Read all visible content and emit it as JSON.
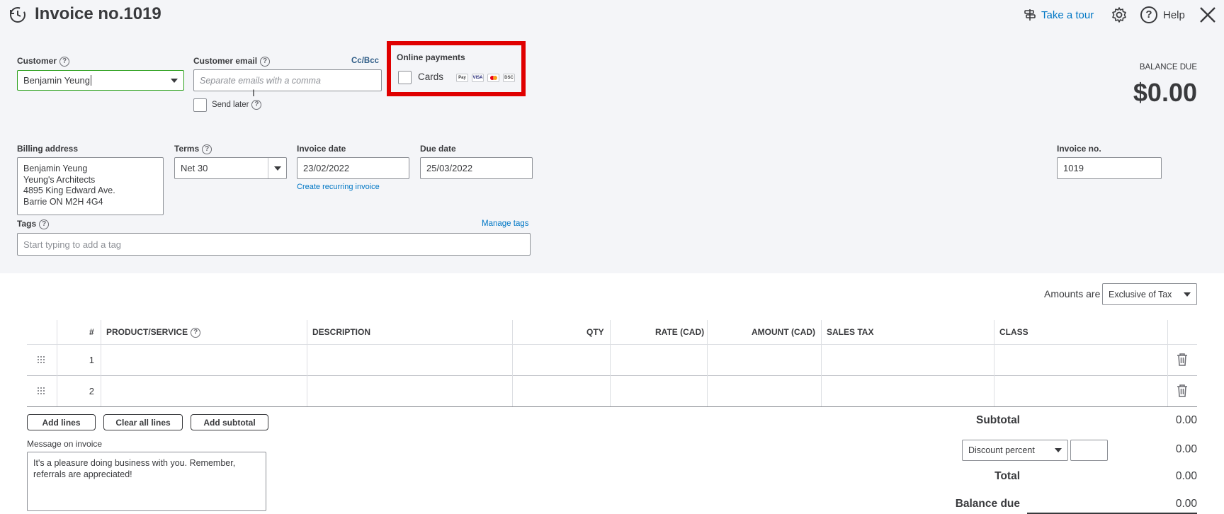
{
  "header": {
    "title": "Invoice no.1019",
    "take_tour": "Take a tour",
    "help": "Help"
  },
  "customer": {
    "label": "Customer",
    "value": "Benjamin Yeung"
  },
  "email": {
    "label": "Customer email",
    "cc_bcc": "Cc/Bcc",
    "placeholder": "Separate emails with a comma",
    "send_later": "Send later"
  },
  "online_payments": {
    "title": "Online payments",
    "cards_label": "Cards",
    "highlight_color": "#e00000"
  },
  "balance": {
    "label": "BALANCE DUE",
    "amount": "$0.00"
  },
  "billing": {
    "label": "Billing address",
    "lines": [
      "Benjamin Yeung",
      "Yeung's Architects",
      "4895 King Edward Ave.",
      "Barrie ON  M2H 4G4"
    ]
  },
  "terms": {
    "label": "Terms",
    "value": "Net 30"
  },
  "invoice_date": {
    "label": "Invoice date",
    "value": "23/02/2022",
    "recurring_link": "Create recurring invoice"
  },
  "due_date": {
    "label": "Due date",
    "value": "25/03/2022"
  },
  "invoice_no": {
    "label": "Invoice no.",
    "value": "1019"
  },
  "tags": {
    "label": "Tags",
    "manage": "Manage tags",
    "placeholder": "Start typing to add a tag"
  },
  "amounts": {
    "label": "Amounts are",
    "value": "Exclusive of Tax"
  },
  "table": {
    "columns": [
      "#",
      "PRODUCT/SERVICE",
      "DESCRIPTION",
      "QTY",
      "RATE (CAD)",
      "AMOUNT (CAD)",
      "SALES TAX",
      "CLASS"
    ],
    "rows": [
      {
        "num": "1"
      },
      {
        "num": "2"
      }
    ]
  },
  "actions": {
    "add_lines": "Add lines",
    "clear_all": "Clear all lines",
    "add_subtotal": "Add subtotal"
  },
  "message": {
    "label": "Message on invoice",
    "value": "It's a pleasure doing business with you.  Remember, referrals are appreciated!"
  },
  "totals": {
    "subtotal_label": "Subtotal",
    "subtotal_value": "0.00",
    "discount_type": "Discount percent",
    "discount_value": "0.00",
    "total_label": "Total",
    "total_value": "0.00",
    "balance_due_label": "Balance due",
    "balance_due_value": "0.00"
  },
  "colors": {
    "link": "#0077c5",
    "customer_border": "#2ca01c"
  }
}
